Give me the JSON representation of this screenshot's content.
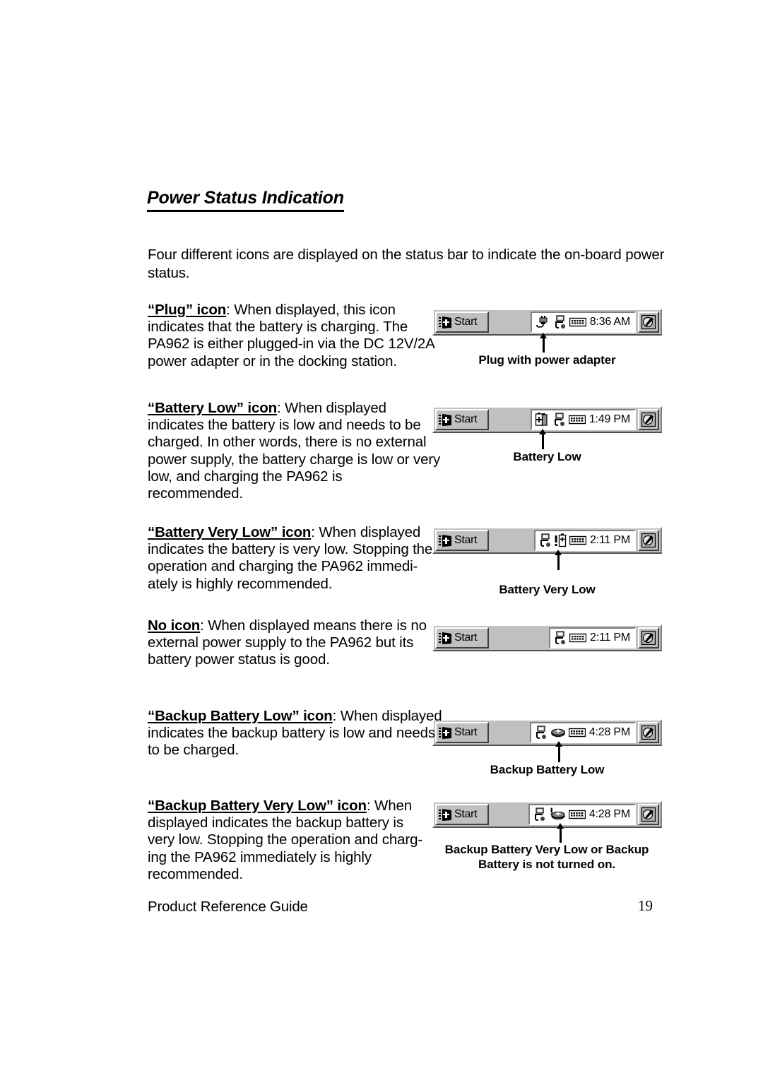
{
  "document": {
    "heading": "Power Status Indication",
    "intro": "Four different icons are displayed on the status bar to indicate the on-board power status.",
    "footer_title": "Product Reference Guide",
    "page_number": "19"
  },
  "sections": [
    {
      "term": "“Plug” icon",
      "body": ":  When displayed, this icon indicates that the battery is charging.  The PA962 is either plugged-in via the DC 12V/2A power adapter or in the docking station.",
      "caption": "Plug with power adapter",
      "taskbar": {
        "start_label": "Start",
        "time": "8:36 AM",
        "icons": [
          "plug-icon",
          "network-connection-icon",
          "keyboard-icon"
        ]
      }
    },
    {
      "term": "“Battery Low” icon",
      "body": ":  When displayed indicates the battery is low and needs to be charged.  In other words, there is no external power supply, the battery charge is low or very low, and charging the PA962 is recommended.",
      "caption": "Battery Low",
      "taskbar": {
        "start_label": "Start",
        "time": "1:49 PM",
        "icons": [
          "battery-low-icon",
          "network-connection-icon",
          "keyboard-icon"
        ]
      }
    },
    {
      "term": "“Battery Very Low” icon",
      "body": ":  When displayed indicates the battery is very low.  Stopping the operation and charging the PA962 immedi-ately is highly recommended.",
      "caption": "Battery Very Low",
      "taskbar": {
        "start_label": "Start",
        "time": "2:11 PM",
        "icons": [
          "network-connection-icon",
          "battery-very-low-icon",
          "keyboard-icon"
        ]
      }
    },
    {
      "term": "No icon",
      "body": ":  When displayed means there is no external power supply to the PA962 but its battery power status is good.",
      "caption": "",
      "taskbar": {
        "start_label": "Start",
        "time": "2:11 PM",
        "icons": [
          "network-connection-icon",
          "keyboard-icon"
        ]
      }
    },
    {
      "term": "“Backup Battery Low” icon",
      "body": ":  When displayed indicates the backup battery is low and needs to be charged.",
      "caption": "Backup Battery Low",
      "taskbar": {
        "start_label": "Start",
        "time": "4:28 PM",
        "icons": [
          "network-connection-icon",
          "backup-battery-low-icon",
          "keyboard-icon"
        ]
      }
    },
    {
      "term": "“Backup Battery Very Low” icon",
      "body": ":  When displayed indicates the backup battery is very low.  Stopping the operation and charg-ing the PA962 immediately is highly recommended.",
      "caption": "Backup Battery Very Low or Backup\nBattery is not turned on.",
      "taskbar": {
        "start_label": "Start",
        "time": "4:28 PM",
        "icons": [
          "network-connection-icon",
          "backup-battery-very-low-icon",
          "keyboard-icon"
        ]
      }
    }
  ],
  "colors": {
    "page_background": "#ffffff",
    "text": "#000000",
    "taskbar_face": "#c0c0c0",
    "tray_background": "#ffffff",
    "bevel_light": "#ffffff",
    "bevel_dark": "#404040"
  }
}
